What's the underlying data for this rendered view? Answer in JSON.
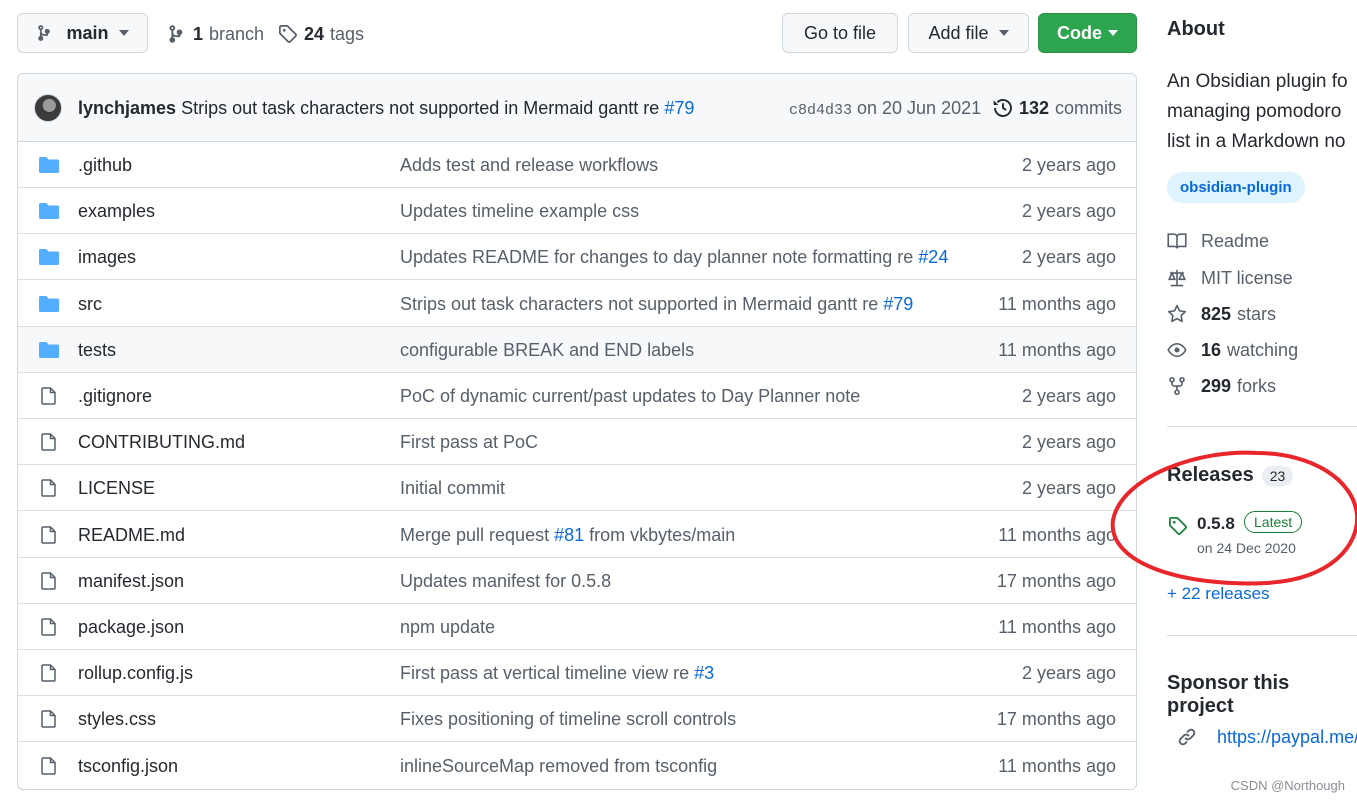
{
  "toolbar": {
    "branch_label": "main",
    "branches_count": "1",
    "branches_label": "branch",
    "tags_count": "24",
    "tags_label": "tags",
    "go_to_file": "Go to file",
    "add_file": "Add file",
    "code": "Code"
  },
  "commit": {
    "author": "lynchjames",
    "message": "Strips out task characters not supported in Mermaid gantt re",
    "issue": "#79",
    "sha": "c8d4d33",
    "date": "on 20 Jun 2021",
    "count": "132",
    "count_label": "commits"
  },
  "files": [
    {
      "type": "dir",
      "name": ".github",
      "message": "Adds test and release workflows",
      "ref": "",
      "suffix": "",
      "age": "2 years ago"
    },
    {
      "type": "dir",
      "name": "examples",
      "message": "Updates timeline example css",
      "ref": "",
      "suffix": "",
      "age": "2 years ago"
    },
    {
      "type": "dir",
      "name": "images",
      "message": "Updates README for changes to day planner note formatting re",
      "ref": "#24",
      "suffix": "",
      "age": "2 years ago"
    },
    {
      "type": "dir",
      "name": "src",
      "message": "Strips out task characters not supported in Mermaid gantt re",
      "ref": "#79",
      "suffix": "",
      "age": "11 months ago"
    },
    {
      "type": "dir",
      "name": "tests",
      "message": "configurable BREAK and END labels",
      "ref": "",
      "suffix": "",
      "age": "11 months ago"
    },
    {
      "type": "file",
      "name": ".gitignore",
      "message": "PoC of dynamic current/past updates to Day Planner note",
      "ref": "",
      "suffix": "",
      "age": "2 years ago"
    },
    {
      "type": "file",
      "name": "CONTRIBUTING.md",
      "message": "First pass at PoC",
      "ref": "",
      "suffix": "",
      "age": "2 years ago"
    },
    {
      "type": "file",
      "name": "LICENSE",
      "message": "Initial commit",
      "ref": "",
      "suffix": "",
      "age": "2 years ago"
    },
    {
      "type": "file",
      "name": "README.md",
      "message": "Merge pull request",
      "ref": "#81",
      "suffix": "from vkbytes/main",
      "age": "11 months ago"
    },
    {
      "type": "file",
      "name": "manifest.json",
      "message": "Updates manifest for 0.5.8",
      "ref": "",
      "suffix": "",
      "age": "17 months ago"
    },
    {
      "type": "file",
      "name": "package.json",
      "message": "npm update",
      "ref": "",
      "suffix": "",
      "age": "11 months ago"
    },
    {
      "type": "file",
      "name": "rollup.config.js",
      "message": "First pass at vertical timeline view re",
      "ref": "#3",
      "suffix": "",
      "age": "2 years ago"
    },
    {
      "type": "file",
      "name": "styles.css",
      "message": "Fixes positioning of timeline scroll controls",
      "ref": "",
      "suffix": "",
      "age": "17 months ago"
    },
    {
      "type": "file",
      "name": "tsconfig.json",
      "message": "inlineSourceMap removed from tsconfig",
      "ref": "",
      "suffix": "",
      "age": "11 months ago"
    }
  ],
  "about": {
    "heading": "About",
    "description_lines": [
      "An Obsidian plugin fo",
      "managing pomodoro",
      "list in a Markdown no"
    ],
    "topic": "obsidian-plugin",
    "readme": "Readme",
    "license": "MIT license",
    "stars_count": "825",
    "stars_label": "stars",
    "watching_count": "16",
    "watching_label": "watching",
    "forks_count": "299",
    "forks_label": "forks"
  },
  "releases": {
    "heading": "Releases",
    "count": "23",
    "latest_version": "0.5.8",
    "latest_badge": "Latest",
    "latest_date": "on 24 Dec 2020",
    "more_link": "+ 22 releases"
  },
  "sponsor": {
    "heading": "Sponsor this project",
    "link": "https://paypal.me/"
  },
  "watermark": "CSDN @Northough",
  "colors": {
    "accent": "#0969da",
    "code_button": "#2da44e",
    "folder": "#54aeff",
    "latest_badge": "#1a7f37",
    "topic_bg": "#ddf4ff",
    "annotation": "#e8262b"
  }
}
